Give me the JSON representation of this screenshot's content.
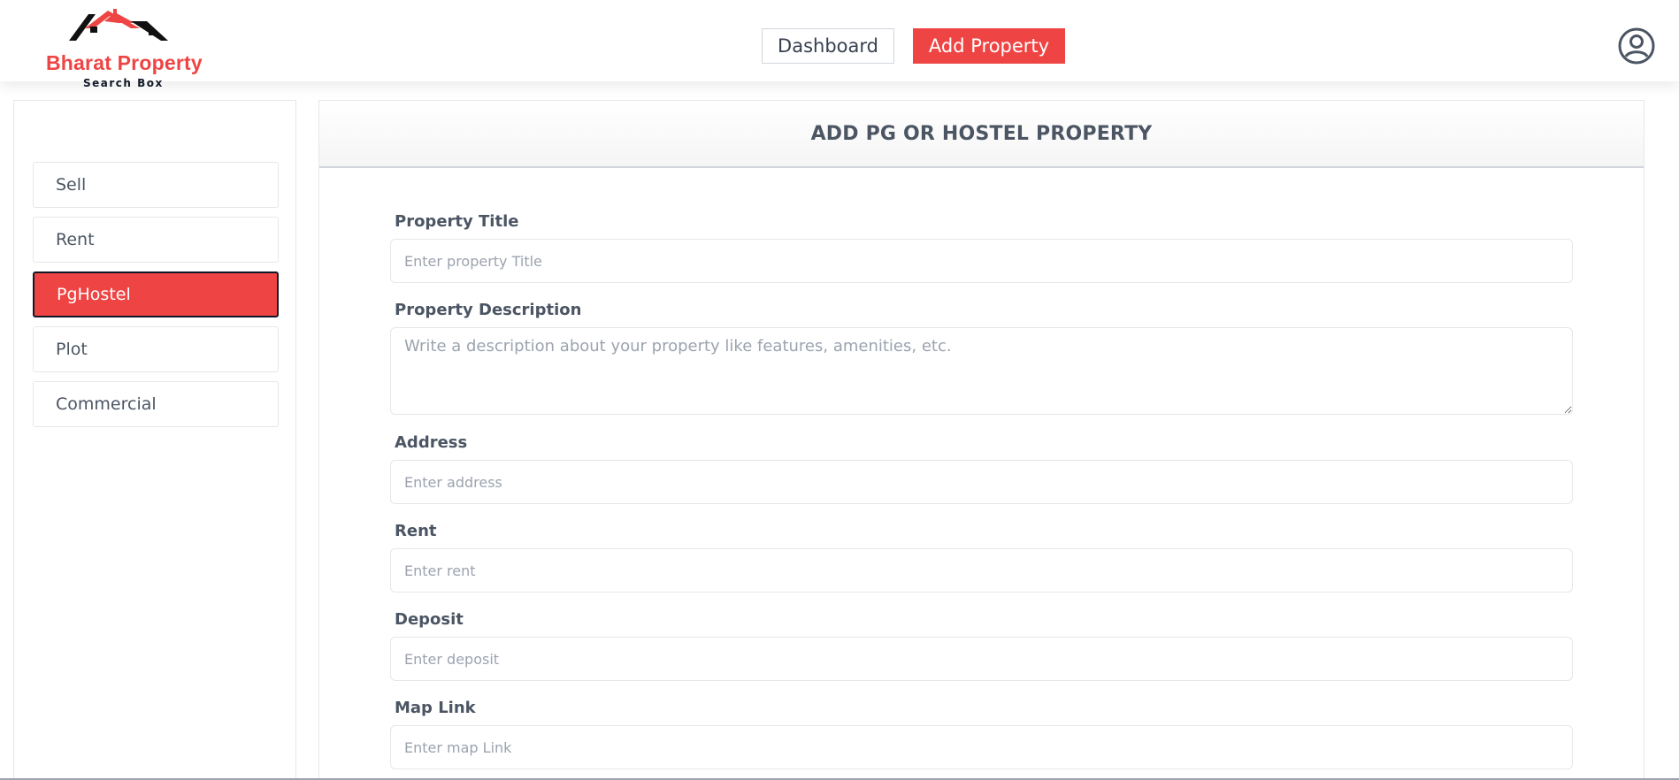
{
  "header": {
    "logo_title": "Bharat Property",
    "logo_subtitle": "Search Box",
    "nav": {
      "dashboard": "Dashboard",
      "add_property": "Add Property"
    }
  },
  "sidebar": {
    "items": [
      {
        "label": "Sell",
        "active": false
      },
      {
        "label": "Rent",
        "active": false
      },
      {
        "label": "PgHostel",
        "active": true
      },
      {
        "label": "Plot",
        "active": false
      },
      {
        "label": "Commercial",
        "active": false
      }
    ]
  },
  "form": {
    "title": "ADD PG OR HOSTEL PROPERTY",
    "fields": {
      "title": {
        "label": "Property Title",
        "placeholder": "Enter property Title",
        "value": ""
      },
      "description": {
        "label": "Property Description",
        "placeholder": "Write a description about your property like features, amenities, etc.",
        "value": ""
      },
      "address": {
        "label": "Address",
        "placeholder": "Enter address",
        "value": ""
      },
      "rent": {
        "label": "Rent",
        "placeholder": "Enter rent",
        "value": ""
      },
      "deposit": {
        "label": "Deposit",
        "placeholder": "Enter deposit",
        "value": ""
      },
      "map_link": {
        "label": "Map Link",
        "placeholder": "Enter map Link",
        "value": ""
      }
    }
  },
  "colors": {
    "accent": "#ef4444",
    "text": "#4b5563",
    "border": "#e5e7eb"
  },
  "icons": {
    "logo": "house-roof-logo-icon",
    "user": "user-circle-icon"
  }
}
